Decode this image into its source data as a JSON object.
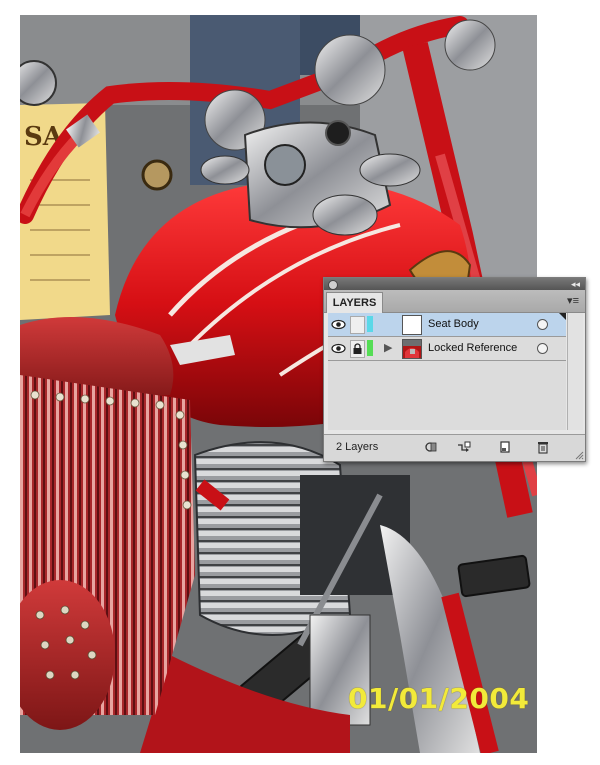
{
  "photo": {
    "date_stamp": "01/01/2004",
    "sign_text": "SA"
  },
  "layers_panel": {
    "tab_label": "LAYERS",
    "collapse_glyph": "◂◂",
    "menu_glyph": "▾≡",
    "layers": [
      {
        "name": "Seat Body",
        "selected": true,
        "locked": false,
        "color": "#5ad8e8"
      },
      {
        "name": "Locked Reference",
        "selected": false,
        "locked": true,
        "color": "#55dd55"
      }
    ],
    "footer_count": "2 Layers"
  },
  "icons": {
    "visibility": "eye-icon",
    "lock": "lock-icon",
    "expand": "triangle-right-icon",
    "target": "circle-icon",
    "make_clipping_mask": "clipping-mask-icon",
    "create_sublayer": "new-sublayer-icon",
    "create_layer": "new-layer-icon",
    "delete": "trash-icon"
  }
}
